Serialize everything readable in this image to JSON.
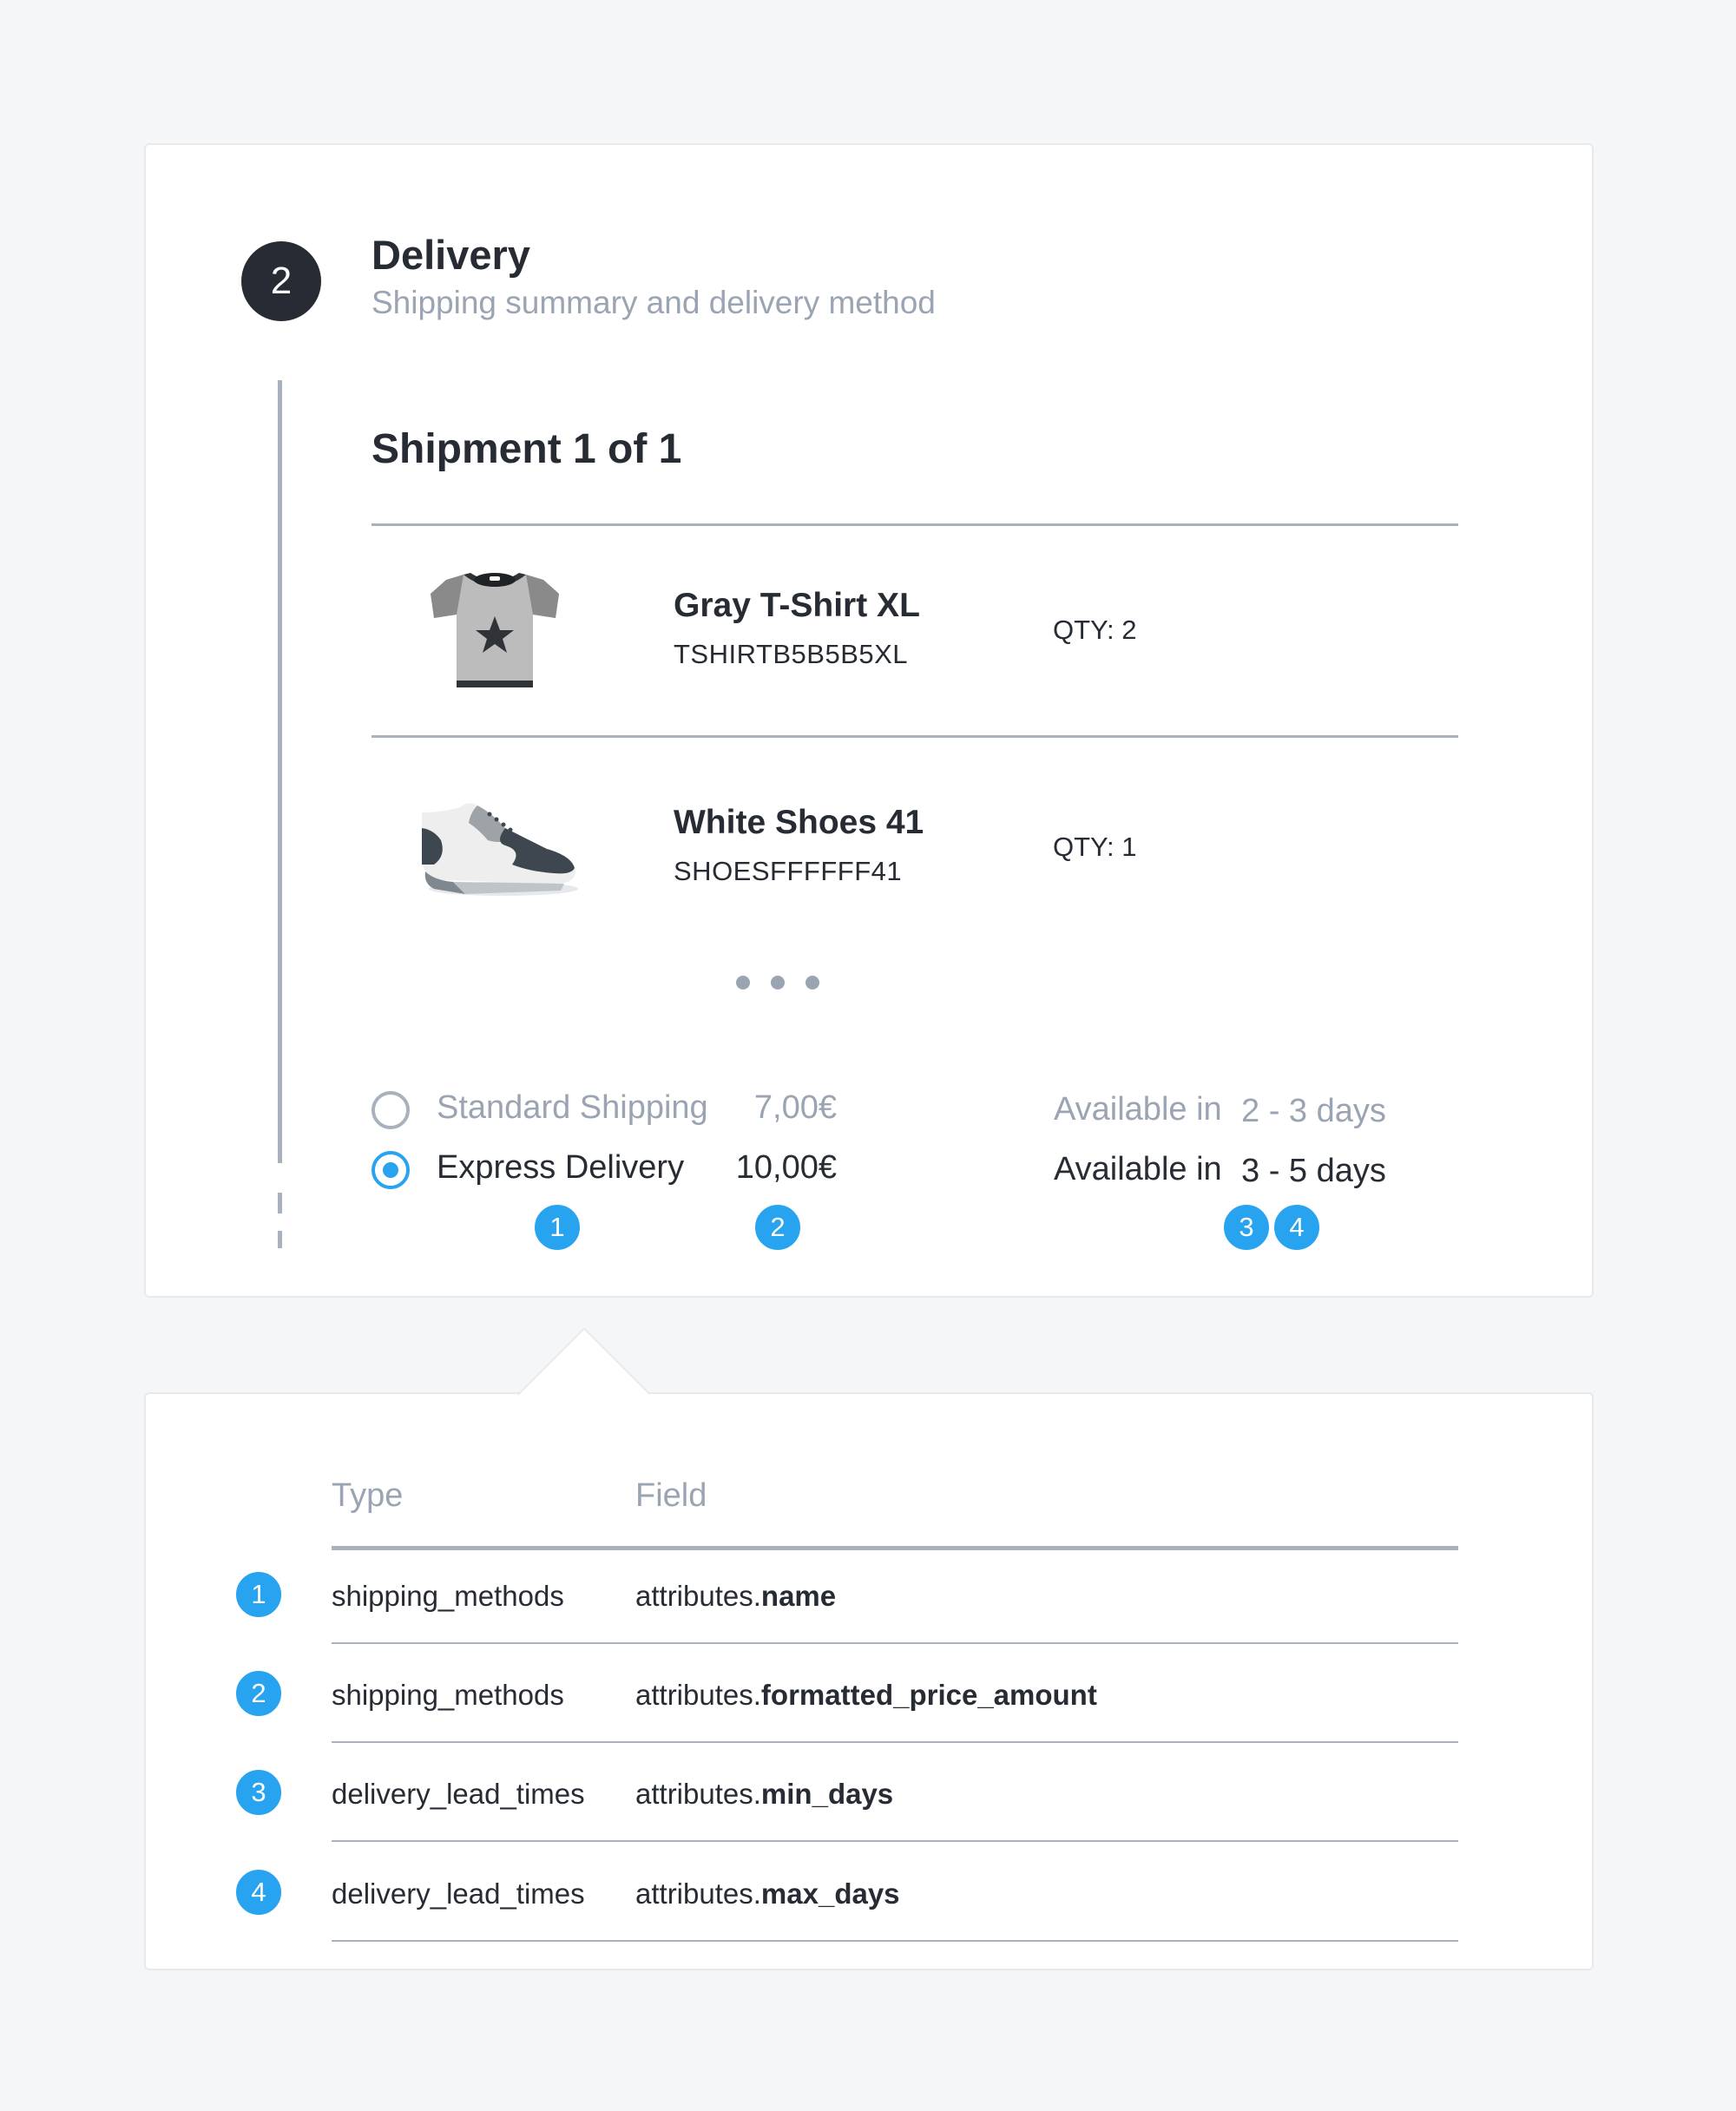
{
  "step": {
    "number": "2",
    "title": "Delivery",
    "subtitle": "Shipping summary and delivery method"
  },
  "shipment": {
    "title": "Shipment 1 of 1",
    "items": [
      {
        "name": "Gray T-Shirt XL",
        "sku": "TSHIRTB5B5B5XL",
        "qty": "QTY: 2",
        "icon": "tshirt-icon"
      },
      {
        "name": "White Shoes 41",
        "sku": "SHOESFFFFFF41",
        "qty": "QTY: 1",
        "icon": "shoe-icon"
      }
    ],
    "more_indicator": "more-dots-icon"
  },
  "delivery_methods": [
    {
      "name": "Standard Shipping",
      "price": "7,00€",
      "available_label": "Available in",
      "days": "2 - 3 days",
      "selected": false
    },
    {
      "name": "Express Delivery",
      "price": "10,00€",
      "available_label": "Available in",
      "days": "3 - 5 days",
      "selected": true
    }
  ],
  "badges": [
    "1",
    "2",
    "3",
    "4"
  ],
  "mapping_table": {
    "headers": {
      "type": "Type",
      "field": "Field"
    },
    "rows": [
      {
        "badge": "1",
        "type": "shipping_methods",
        "field_prefix": "attributes.",
        "field_name": "name"
      },
      {
        "badge": "2",
        "type": "shipping_methods",
        "field_prefix": "attributes.",
        "field_name": "formatted_price_amount"
      },
      {
        "badge": "3",
        "type": "delivery_lead_times",
        "field_prefix": "attributes.",
        "field_name": "min_days"
      },
      {
        "badge": "4",
        "type": "delivery_lead_times",
        "field_prefix": "attributes.",
        "field_name": "max_days"
      }
    ]
  },
  "colors": {
    "accent": "#27a3f0",
    "dark": "#272b33",
    "muted": "#9aa4b2",
    "divider": "#a9b1bd",
    "background": "#f5f6f8"
  }
}
